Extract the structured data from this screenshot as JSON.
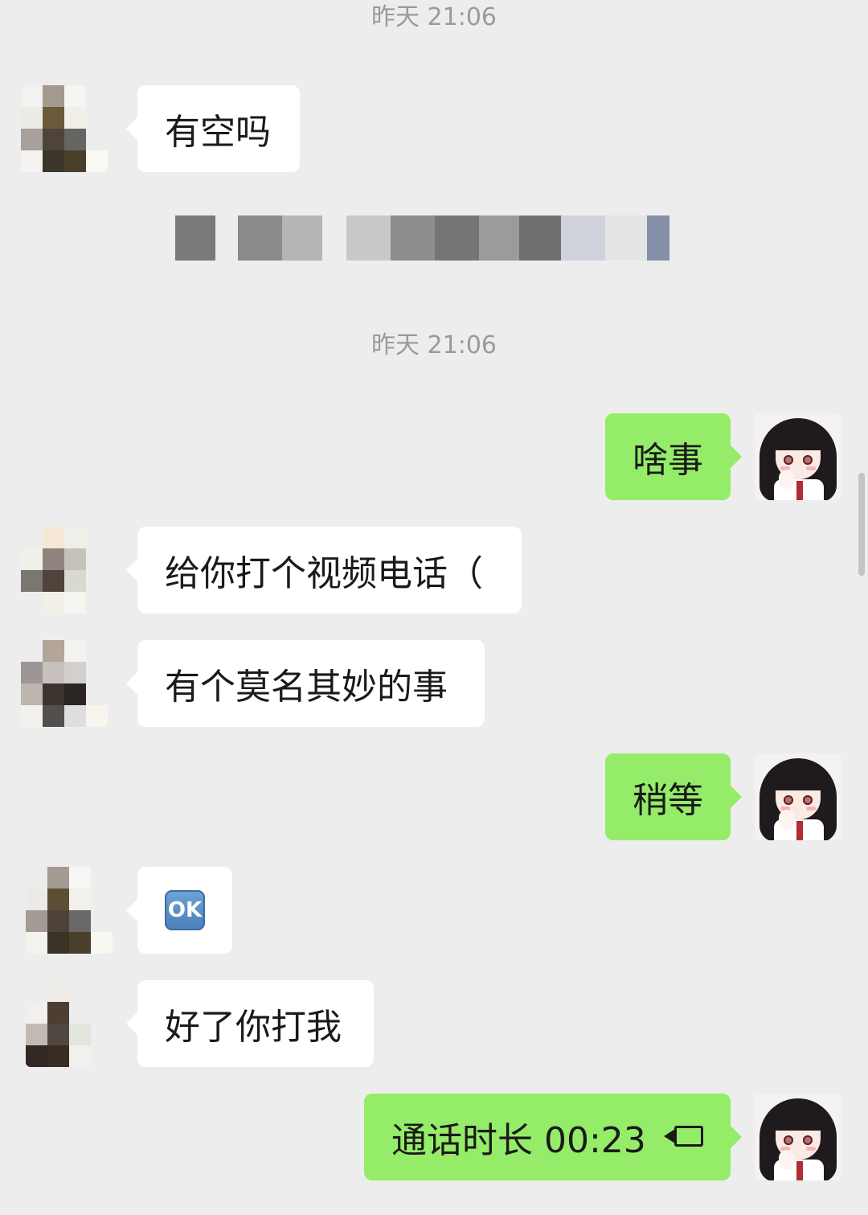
{
  "timestamps": [
    "昨天 21:06",
    "昨天 21:06"
  ],
  "system_notice": "",
  "messages": [
    {
      "from": "other",
      "text": "有空吗"
    },
    {
      "from": "self",
      "text": "啥事"
    },
    {
      "from": "other",
      "text": "给你打个视频电话（"
    },
    {
      "from": "other",
      "text": "有个莫名其妙的事"
    },
    {
      "from": "self",
      "text": "稍等"
    },
    {
      "from": "other",
      "emoji": "OK",
      "emoji_name": "ok-button-emoji"
    },
    {
      "from": "other",
      "text": "好了你打我"
    },
    {
      "from": "self",
      "text": "通话时长 00:23",
      "icon": "video-call-icon"
    }
  ],
  "colors": {
    "background": "#ededed",
    "bubble_in": "#ffffff",
    "bubble_out": "#95ec69",
    "timestamp": "#9a9a9a"
  }
}
